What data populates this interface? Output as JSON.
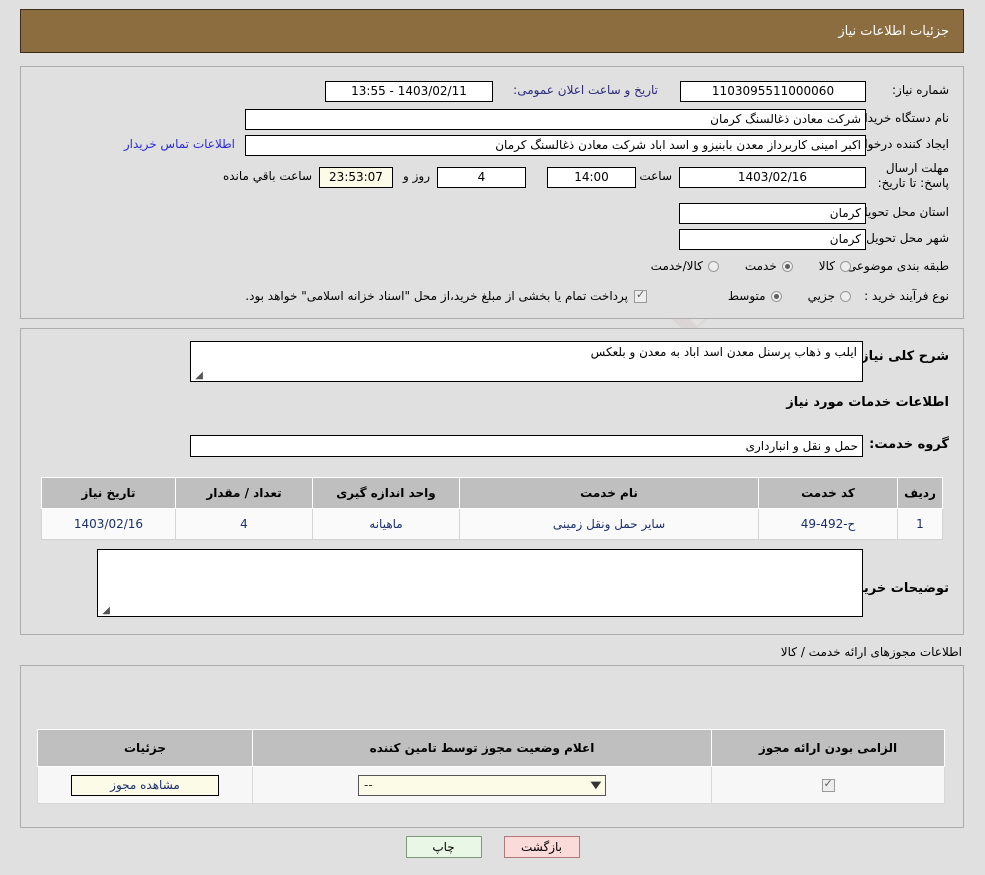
{
  "header": {
    "title": "جزئیات اطلاعات نیاز"
  },
  "form": {
    "need_number_label": "شماره نیاز:",
    "need_number_value": "1103095511000060",
    "announce_label": "تاریخ و ساعت اعلان عمومی:",
    "announce_value": "1403/02/11 - 13:55",
    "buyer_org_label": "نام دستگاه خریدار:",
    "buyer_org_value": "شرکت معادن ذغالسنگ کرمان",
    "creator_label": "ایجاد کننده درخواست:",
    "creator_value": "اکبر امینی کاربرداز معدن بابنیزو و اسد اباد شرکت معادن ذغالسنگ کرمان",
    "contact_link": "اطلاعات تماس خریدار",
    "deadline_label": "مهلت ارسال پاسخ: تا تاریخ:",
    "deadline_date": "1403/02/16",
    "hour_label": "ساعت",
    "deadline_time": "14:00",
    "days_value": "4",
    "days_label": "روز و",
    "remaining_time": "23:53:07",
    "remaining_label": "ساعت باقي مانده",
    "province_label": "استان محل تحویل:",
    "province_value": "کرمان",
    "city_label": "شهر محل تحویل:",
    "city_value": "کرمان",
    "category_label": "طبقه بندی موضوعی:",
    "category_options": [
      {
        "label": "کالا",
        "selected": false
      },
      {
        "label": "خدمت",
        "selected": true
      },
      {
        "label": "کالا/خدمت",
        "selected": false
      }
    ],
    "process_label": "نوع فرآیند خرید :",
    "process_options": [
      {
        "label": "جزیي",
        "selected": false
      },
      {
        "label": "متوسط",
        "selected": true
      }
    ],
    "treasury_checkbox_checked": true,
    "treasury_note": "پرداخت تمام یا بخشی از مبلغ خرید،از محل \"اسناد خزانه اسلامی\" خواهد بود."
  },
  "description": {
    "general_label": "شرح کلی نیاز:",
    "general_value": "ایلب و ذهاب پرسنل معدن اسد اباد به معدن و بلعکس",
    "services_heading": "اطلاعات خدمات مورد نیاز",
    "service_group_label": "گروه خدمت:",
    "service_group_value": "حمل و نقل و انبارداری",
    "buyer_notes_label": "توضیحات خریدار:",
    "buyer_notes_value": ""
  },
  "service_table": {
    "columns": [
      "ردیف",
      "کد خدمت",
      "نام خدمت",
      "واحد اندازه گیری",
      "تعداد / مقدار",
      "تاریخ نیاز"
    ],
    "rows": [
      {
        "row_no": "1",
        "service_code": "ح-492-49",
        "service_name": "سایر حمل ونقل زمینی",
        "unit": "ماهیانه",
        "quantity": "4",
        "need_date": "1403/02/16"
      }
    ]
  },
  "licenses": {
    "section_note": "اطلاعات مجوزهای ارائه خدمت / کالا",
    "columns": [
      "الزامی بودن ارائه مجوز",
      "اعلام وضعیت مجوز توسط تامین کننده",
      "جزئیات"
    ],
    "rows": [
      {
        "required_checked": true,
        "status_value": "--",
        "details_button": "مشاهده مجوز"
      }
    ]
  },
  "footer": {
    "print_label": "چاپ",
    "back_label": "بازگشت"
  },
  "watermark": {
    "text": "TenderNet"
  },
  "colors": {
    "header_bg": "#8c6d3f",
    "page_bg": "#e0e0e0",
    "link": "#2c2cd6",
    "table_header": "#bfbfbf",
    "print_btn": "#e9f7e6",
    "back_btn": "#fbdada"
  }
}
